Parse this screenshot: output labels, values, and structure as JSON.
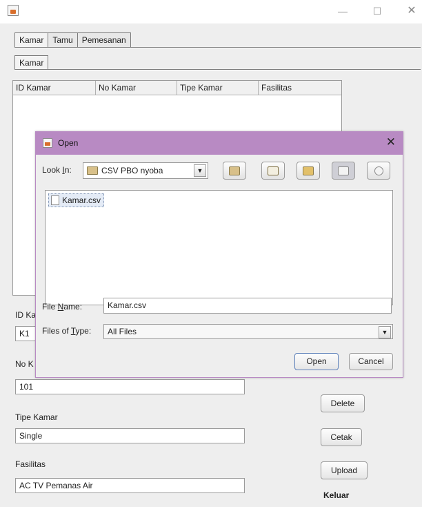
{
  "window": {
    "min_glyph": "—",
    "max_glyph": "☐",
    "close_glyph": "✕"
  },
  "tabs_outer": [
    "Kamar",
    "Tamu",
    "Pemesanan"
  ],
  "tabs_inner": [
    "Kamar"
  ],
  "table": {
    "columns": [
      "ID Kamar",
      "No Kamar",
      "Tipe Kamar",
      "Fasilitas"
    ]
  },
  "form": {
    "id_label": "ID Ka",
    "id_value": "K1",
    "no_label": "No K",
    "no_value": "101",
    "tipe_label": "Tipe Kamar",
    "tipe_value": "Single",
    "fasilitas_label": "Fasilitas",
    "fasilitas_value": "AC TV Pemanas Air"
  },
  "side_buttons": {
    "delete": "Delete",
    "cetak": "Cetak",
    "upload": "Upload",
    "keluar": "Keluar"
  },
  "dialog": {
    "title": "Open",
    "look_in_label_a": "Look ",
    "look_in_label_u": "I",
    "look_in_label_b": "n:",
    "look_in_value": "CSV PBO nyoba",
    "files": [
      "Kamar.csv"
    ],
    "file_name_label_a": "File ",
    "file_name_label_u": "N",
    "file_name_label_b": "ame:",
    "file_name_value": "Kamar.csv",
    "file_type_label_a": "Files of ",
    "file_type_label_u": "T",
    "file_type_label_b": "ype:",
    "file_type_value": "All Files",
    "open_label": "Open",
    "cancel_label": "Cancel"
  }
}
